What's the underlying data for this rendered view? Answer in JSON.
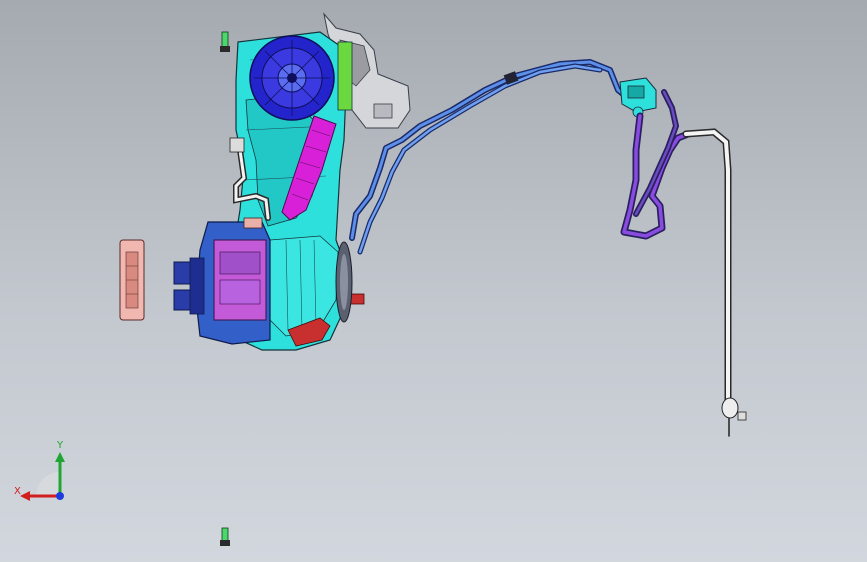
{
  "viewport": {
    "background_top": "#a5aab0",
    "background_bottom": "#d2d7de"
  },
  "triad": {
    "x_label": "X",
    "y_label": "Y",
    "x_color": "#d21e1e",
    "y_color": "#1ea532",
    "z_color": "#1e3cdc"
  },
  "colors": {
    "cyan": "#2ee0dc",
    "blue": "#2222cc",
    "magenta": "#d020d0",
    "tube_blue": "#4a7fd8",
    "purple": "#7a3cc8",
    "red": "#c83030",
    "grey": "#c8cacc",
    "white": "#f0f0f0"
  },
  "model": {
    "name": "",
    "components": [
      "hvac-housing",
      "blower-wheel",
      "evaporator-core",
      "heater-core-module",
      "side-cover-plate",
      "refrigerant-line",
      "expansion-valve",
      "drain-pipe",
      "fastener-bolt"
    ]
  }
}
